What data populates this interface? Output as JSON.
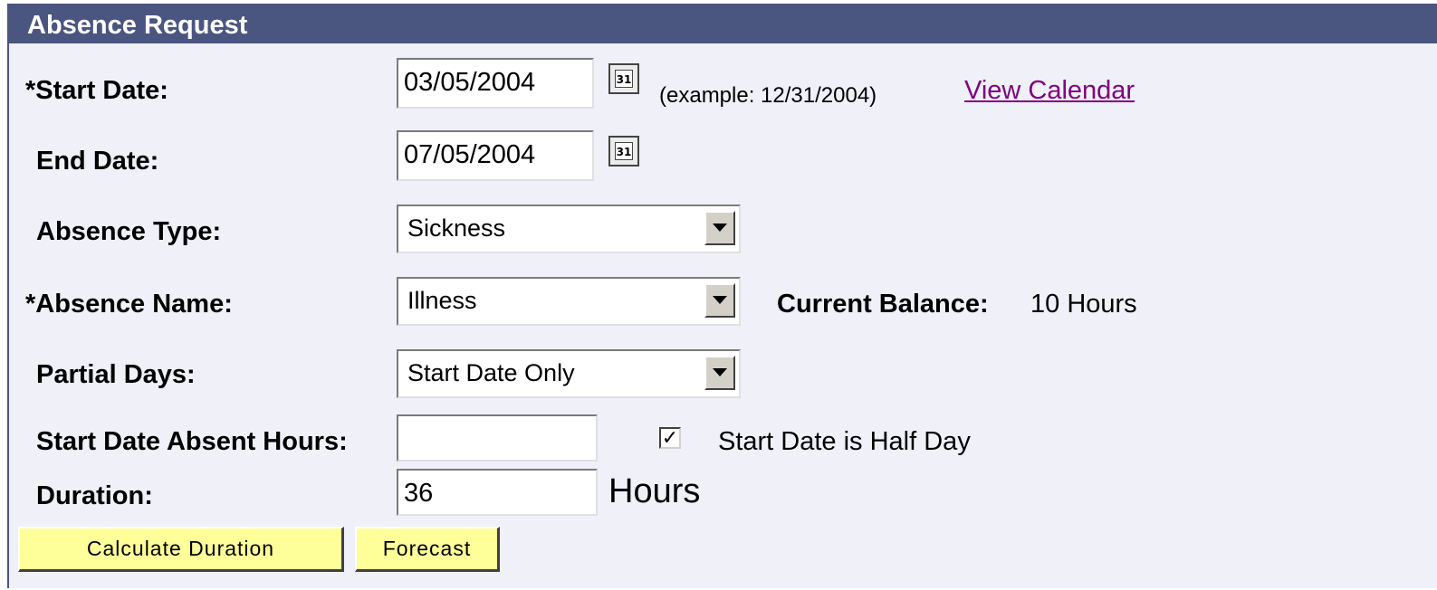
{
  "header": {
    "title": "Absence Request"
  },
  "form": {
    "start_date": {
      "label": "*Start Date:",
      "value": "03/05/2004",
      "example": "(example: 12/31/2004)",
      "calendar_link": "View Calendar",
      "icon": "calendar-icon"
    },
    "end_date": {
      "label": "End Date:",
      "value": "07/05/2004",
      "icon": "calendar-icon"
    },
    "absence_type": {
      "label": "Absence Type:",
      "selected": "Sickness"
    },
    "absence_name": {
      "label": "*Absence Name:",
      "selected": "Illness"
    },
    "current_balance": {
      "label": "Current Balance:",
      "value": "10 Hours"
    },
    "partial_days": {
      "label": "Partial Days:",
      "selected": "Start Date Only"
    },
    "start_date_absent_hours": {
      "label": "Start Date Absent Hours:",
      "value": ""
    },
    "half_day": {
      "label": "Start Date is Half Day",
      "checked": true
    },
    "duration": {
      "label": "Duration:",
      "value": "36",
      "unit": "Hours"
    }
  },
  "buttons": {
    "calculate_duration": "Calculate Duration",
    "forecast": "Forecast"
  },
  "calendar_icon_text": "31",
  "colors": {
    "header_bg": "#4a5580",
    "panel_bg": "#eff0f8",
    "button_bg": "#ffff99",
    "link": "#800080"
  }
}
